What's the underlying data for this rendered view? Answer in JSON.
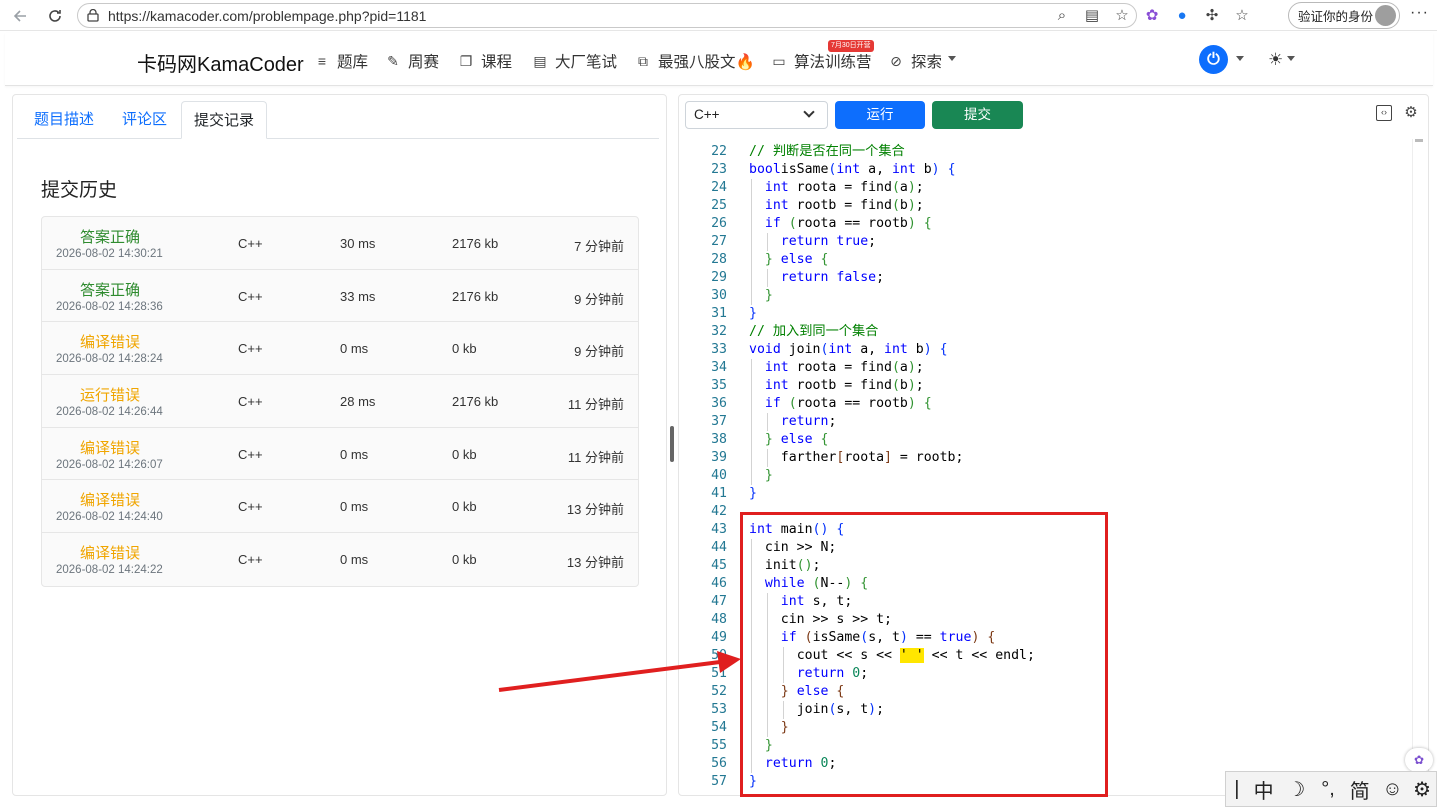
{
  "browser": {
    "url": "https://kamacoder.com/problempage.php?pid=1181",
    "verify_label": "验证你的身份",
    "more": "···"
  },
  "site": {
    "brand": "卡码网KamaCoder",
    "nav": [
      {
        "label": "题库",
        "icon": "list-icon"
      },
      {
        "label": "周赛",
        "icon": "pencil-icon"
      },
      {
        "label": "课程",
        "icon": "copy-icon"
      },
      {
        "label": "大厂笔试",
        "icon": "document-icon"
      },
      {
        "label": "最强八股文🔥",
        "icon": "file-code-icon"
      },
      {
        "label": "算法训练营",
        "icon": "calendar-icon"
      },
      {
        "label": "探索",
        "icon": "compass-icon"
      }
    ],
    "camp_badge": "7月30日开营"
  },
  "left": {
    "tabs": [
      "题目描述",
      "评论区",
      "提交记录"
    ],
    "active_tab": "提交记录",
    "history_title": "提交历史",
    "submissions": [
      {
        "status": "答案正确",
        "kind": "ok",
        "time": "2026-08-02 14:30:21",
        "lang": "C++",
        "ms": "30 ms",
        "kb": "2176 kb",
        "ago": "7 分钟前"
      },
      {
        "status": "答案正确",
        "kind": "ok",
        "time": "2026-08-02 14:28:36",
        "lang": "C++",
        "ms": "33 ms",
        "kb": "2176 kb",
        "ago": "9 分钟前"
      },
      {
        "status": "编译错误",
        "kind": "err",
        "time": "2026-08-02 14:28:24",
        "lang": "C++",
        "ms": "0 ms",
        "kb": "0 kb",
        "ago": "9 分钟前"
      },
      {
        "status": "运行错误",
        "kind": "err",
        "time": "2026-08-02 14:26:44",
        "lang": "C++",
        "ms": "28 ms",
        "kb": "2176 kb",
        "ago": "11 分钟前"
      },
      {
        "status": "编译错误",
        "kind": "err",
        "time": "2026-08-02 14:26:07",
        "lang": "C++",
        "ms": "0 ms",
        "kb": "0 kb",
        "ago": "11 分钟前"
      },
      {
        "status": "编译错误",
        "kind": "err",
        "time": "2026-08-02 14:24:40",
        "lang": "C++",
        "ms": "0 ms",
        "kb": "0 kb",
        "ago": "13 分钟前"
      },
      {
        "status": "编译错误",
        "kind": "err",
        "time": "2026-08-02 14:24:22",
        "lang": "C++",
        "ms": "0 ms",
        "kb": "0 kb",
        "ago": "13 分钟前"
      }
    ]
  },
  "editor": {
    "language": "C++",
    "run_label": "运行",
    "submit_label": "提交",
    "first_line": 22,
    "lines": [
      {
        "n": 22,
        "d": 0,
        "t": [
          [
            "cm",
            "// 判断是否在同一个集合"
          ]
        ]
      },
      {
        "n": 23,
        "d": 0,
        "t": [
          [
            "kw",
            "bool"
          ],
          [
            "",
            "isSame"
          ],
          [
            "br1",
            "("
          ],
          [
            "kw",
            "int"
          ],
          [
            "",
            " a, "
          ],
          [
            "kw",
            "int"
          ],
          [
            "",
            " b"
          ],
          [
            "br1",
            ")"
          ],
          [
            "",
            " "
          ],
          [
            "br1",
            "{"
          ]
        ]
      },
      {
        "n": 24,
        "d": 1,
        "t": [
          [
            "kw",
            "int"
          ],
          [
            "",
            " roota = find"
          ],
          [
            "br2",
            "("
          ],
          [
            "",
            "a"
          ],
          [
            "br2",
            ")"
          ],
          [
            "",
            ";"
          ]
        ]
      },
      {
        "n": 25,
        "d": 1,
        "t": [
          [
            "kw",
            "int"
          ],
          [
            "",
            " rootb = find"
          ],
          [
            "br2",
            "("
          ],
          [
            "",
            "b"
          ],
          [
            "br2",
            ")"
          ],
          [
            "",
            ";"
          ]
        ]
      },
      {
        "n": 26,
        "d": 1,
        "t": [
          [
            "kw",
            "if"
          ],
          [
            "",
            " "
          ],
          [
            "br2",
            "("
          ],
          [
            "",
            "roota == rootb"
          ],
          [
            "br2",
            ")"
          ],
          [
            "",
            " "
          ],
          [
            "br2",
            "{"
          ]
        ]
      },
      {
        "n": 27,
        "d": 2,
        "t": [
          [
            "kw",
            "return"
          ],
          [
            "",
            " "
          ],
          [
            "kw",
            "true"
          ],
          [
            "",
            ";"
          ]
        ]
      },
      {
        "n": 28,
        "d": 1,
        "t": [
          [
            "br2",
            "}"
          ],
          [
            "",
            " "
          ],
          [
            "kw",
            "else"
          ],
          [
            "",
            " "
          ],
          [
            "br2",
            "{"
          ]
        ]
      },
      {
        "n": 29,
        "d": 2,
        "t": [
          [
            "kw",
            "return"
          ],
          [
            "",
            " "
          ],
          [
            "kw",
            "false"
          ],
          [
            "",
            ";"
          ]
        ]
      },
      {
        "n": 30,
        "d": 1,
        "t": [
          [
            "br2",
            "}"
          ]
        ]
      },
      {
        "n": 31,
        "d": 0,
        "t": [
          [
            "br1",
            "}"
          ]
        ]
      },
      {
        "n": 32,
        "d": 0,
        "t": [
          [
            "cm",
            "// 加入到同一个集合"
          ]
        ]
      },
      {
        "n": 33,
        "d": 0,
        "t": [
          [
            "kw",
            "void"
          ],
          [
            "",
            " join"
          ],
          [
            "br1",
            "("
          ],
          [
            "kw",
            "int"
          ],
          [
            "",
            " a, "
          ],
          [
            "kw",
            "int"
          ],
          [
            "",
            " b"
          ],
          [
            "br1",
            ")"
          ],
          [
            "",
            " "
          ],
          [
            "br1",
            "{"
          ]
        ]
      },
      {
        "n": 34,
        "d": 1,
        "t": [
          [
            "kw",
            "int"
          ],
          [
            "",
            " roota = find"
          ],
          [
            "br2",
            "("
          ],
          [
            "",
            "a"
          ],
          [
            "br2",
            ")"
          ],
          [
            "",
            ";"
          ]
        ]
      },
      {
        "n": 35,
        "d": 1,
        "t": [
          [
            "kw",
            "int"
          ],
          [
            "",
            " rootb = find"
          ],
          [
            "br2",
            "("
          ],
          [
            "",
            "b"
          ],
          [
            "br2",
            ")"
          ],
          [
            "",
            ";"
          ]
        ]
      },
      {
        "n": 36,
        "d": 1,
        "t": [
          [
            "kw",
            "if"
          ],
          [
            "",
            " "
          ],
          [
            "br2",
            "("
          ],
          [
            "",
            "roota == rootb"
          ],
          [
            "br2",
            ")"
          ],
          [
            "",
            " "
          ],
          [
            "br2",
            "{"
          ]
        ]
      },
      {
        "n": 37,
        "d": 2,
        "t": [
          [
            "kw",
            "return"
          ],
          [
            "",
            ";"
          ]
        ]
      },
      {
        "n": 38,
        "d": 1,
        "t": [
          [
            "br2",
            "}"
          ],
          [
            "",
            " "
          ],
          [
            "kw",
            "else"
          ],
          [
            "",
            " "
          ],
          [
            "br2",
            "{"
          ]
        ]
      },
      {
        "n": 39,
        "d": 2,
        "t": [
          [
            "",
            "farther"
          ],
          [
            "br3",
            "["
          ],
          [
            "",
            "roota"
          ],
          [
            "br3",
            "]"
          ],
          [
            "",
            " = rootb;"
          ]
        ]
      },
      {
        "n": 40,
        "d": 1,
        "t": [
          [
            "br2",
            "}"
          ]
        ]
      },
      {
        "n": 41,
        "d": 0,
        "t": [
          [
            "br1",
            "}"
          ]
        ]
      },
      {
        "n": 42,
        "d": 0,
        "t": []
      },
      {
        "n": 43,
        "d": 0,
        "t": [
          [
            "kw",
            "int"
          ],
          [
            "",
            " main"
          ],
          [
            "br1",
            "()"
          ],
          [
            "",
            " "
          ],
          [
            "br1",
            "{"
          ]
        ]
      },
      {
        "n": 44,
        "d": 1,
        "t": [
          [
            "",
            "cin >> N;"
          ]
        ]
      },
      {
        "n": 45,
        "d": 1,
        "t": [
          [
            "",
            "init"
          ],
          [
            "br2",
            "()"
          ],
          [
            "",
            ";"
          ]
        ]
      },
      {
        "n": 46,
        "d": 1,
        "t": [
          [
            "kw",
            "while"
          ],
          [
            "",
            " "
          ],
          [
            "br2",
            "("
          ],
          [
            "",
            "N--"
          ],
          [
            "br2",
            ")"
          ],
          [
            "",
            " "
          ],
          [
            "br2",
            "{"
          ]
        ]
      },
      {
        "n": 47,
        "d": 2,
        "t": [
          [
            "kw",
            "int"
          ],
          [
            "",
            " s, t;"
          ]
        ]
      },
      {
        "n": 48,
        "d": 2,
        "t": [
          [
            "",
            "cin >> s >> t;"
          ]
        ]
      },
      {
        "n": 49,
        "d": 2,
        "t": [
          [
            "kw",
            "if"
          ],
          [
            "",
            " "
          ],
          [
            "br3",
            "("
          ],
          [
            "",
            "isSame"
          ],
          [
            "br1",
            "("
          ],
          [
            "",
            "s, t"
          ],
          [
            "br1",
            ")"
          ],
          [
            "",
            " == "
          ],
          [
            "kw",
            "true"
          ],
          [
            "br3",
            ")"
          ],
          [
            "",
            " "
          ],
          [
            "br3",
            "{"
          ]
        ]
      },
      {
        "n": 50,
        "d": 3,
        "t": [
          [
            "",
            "cout << s << "
          ],
          [
            "hl",
            "' '"
          ],
          [
            "",
            " << t << endl;"
          ]
        ]
      },
      {
        "n": 51,
        "d": 3,
        "t": [
          [
            "kw",
            "return"
          ],
          [
            "",
            " "
          ],
          [
            "nm",
            "0"
          ],
          [
            "",
            ";"
          ]
        ]
      },
      {
        "n": 52,
        "d": 2,
        "t": [
          [
            "br3",
            "}"
          ],
          [
            "",
            " "
          ],
          [
            "kw",
            "else"
          ],
          [
            "",
            " "
          ],
          [
            "br3",
            "{"
          ]
        ]
      },
      {
        "n": 53,
        "d": 3,
        "t": [
          [
            "",
            "join"
          ],
          [
            "br1",
            "("
          ],
          [
            "",
            "s, t"
          ],
          [
            "br1",
            ")"
          ],
          [
            "",
            ";"
          ]
        ]
      },
      {
        "n": 54,
        "d": 2,
        "t": [
          [
            "br3",
            "}"
          ]
        ]
      },
      {
        "n": 55,
        "d": 1,
        "t": [
          [
            "br2",
            "}"
          ]
        ]
      },
      {
        "n": 56,
        "d": 1,
        "t": [
          [
            "kw",
            "return"
          ],
          [
            "",
            " "
          ],
          [
            "nm",
            "0"
          ],
          [
            "",
            ";"
          ]
        ]
      },
      {
        "n": 57,
        "d": 0,
        "t": [
          [
            "br1",
            "}"
          ]
        ]
      }
    ]
  },
  "ime": {
    "items": [
      "|",
      "中",
      "☽",
      "°,",
      "简",
      "☺",
      "⚙"
    ]
  },
  "colors": {
    "primary": "#0d6efd",
    "success": "#198754",
    "ok_text": "#2e8b2e",
    "err_text": "#f0a500",
    "annotation": "#e01f1f"
  }
}
